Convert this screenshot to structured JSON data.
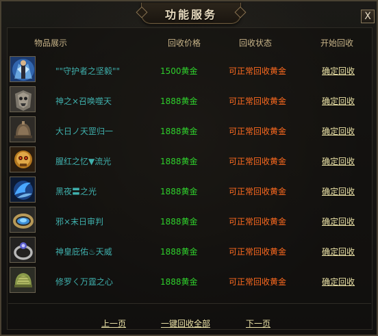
{
  "window": {
    "title": "功能服务",
    "close_label": "X"
  },
  "headers": {
    "items": "物品展示",
    "price": "回收价格",
    "status": "回收状态",
    "start": "开始回收"
  },
  "rows": [
    {
      "icon": "warrior-figure-icon",
      "name": "\"\"守护者之坚毅\"\"",
      "price": "1500黄金",
      "status": "可正常回收黄金",
      "action": "确定回收"
    },
    {
      "icon": "skull-armor-icon",
      "name": "神之×召唤噬天",
      "price": "1888黄金",
      "status": "可正常回收黄金",
      "action": "确定回收"
    },
    {
      "icon": "bell-helmet-icon",
      "name": "大日ノ天罡归一",
      "price": "1888黄金",
      "status": "可正常回收黄金",
      "action": "确定回收"
    },
    {
      "icon": "golden-skull-icon",
      "name": "腥红之忆▼流光",
      "price": "1888黄金",
      "status": "可正常回收黄金",
      "action": "确定回收"
    },
    {
      "icon": "blue-wings-icon",
      "name": "黑夜〓之光",
      "price": "1888黄金",
      "status": "可正常回收黄金",
      "action": "确定回收"
    },
    {
      "icon": "blue-ring-icon",
      "name": "邪×末日审判",
      "price": "1888黄金",
      "status": "可正常回收黄金",
      "action": "确定回收"
    },
    {
      "icon": "gem-ring-icon",
      "name": "神皇庇佑♨天威",
      "price": "1888黄金",
      "status": "可正常回收黄金",
      "action": "确定回收"
    },
    {
      "icon": "green-helmet-icon",
      "name": "修罗ㄑ万霆之心",
      "price": "1888黄金",
      "status": "可正常回收黄金",
      "action": "确定回收"
    }
  ],
  "footer": {
    "prev": "上一页",
    "recycle_all": "一键回收全部",
    "next": "下一页"
  },
  "colors": {
    "item_name": "#3fb0ad",
    "price": "#2fd12c",
    "status": "#ff6a1f",
    "link": "#ece3a6",
    "header": "#c9b589"
  }
}
